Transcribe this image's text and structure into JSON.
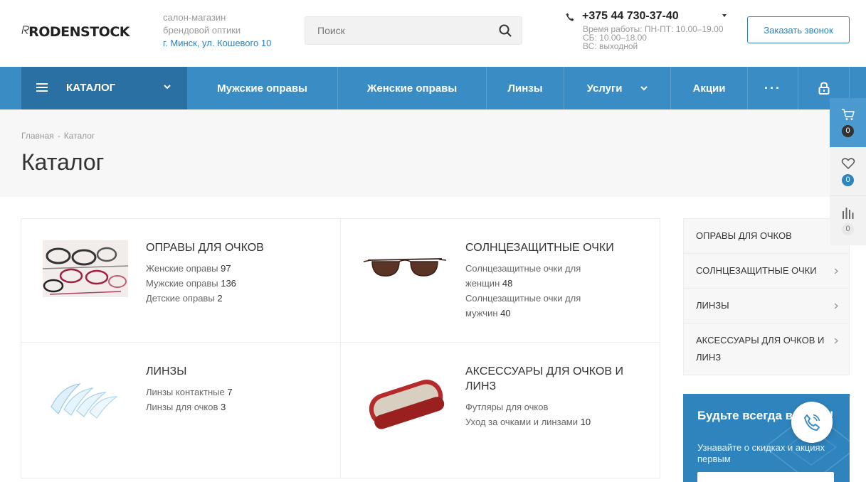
{
  "header": {
    "logo_text": "RODENSTOCK",
    "slogan_line1": "салон-магазин",
    "slogan_line2": "брендовой оптики",
    "address": "г. Минск, ул. Кошевого 10",
    "search_placeholder": "Поиск",
    "phone": "+375 44 730-37-40",
    "hours_line1": "Время работы: ПН-ПТ: 10.00–19.00",
    "hours_line2": "СБ: 10.00–18.00",
    "hours_line3": "ВС: выходной",
    "callback_label": "Заказать звонок"
  },
  "nav": {
    "catalog_label": "КАТАЛОГ",
    "items": [
      "Мужские оправы",
      "Женские оправы",
      "Линзы",
      "Услуги",
      "Акции",
      "···"
    ]
  },
  "breadcrumb": {
    "home": "Главная",
    "separator": "-",
    "current": "Каталог"
  },
  "page_title": "Каталог",
  "categories": [
    {
      "title": "ОПРАВЫ ДЛЯ ОЧКОВ",
      "links": [
        {
          "label": "Женские оправы",
          "count": "97"
        },
        {
          "label": "Мужские оправы",
          "count": "136"
        },
        {
          "label": "Детские оправы",
          "count": "2"
        }
      ]
    },
    {
      "title": "СОЛНЦЕЗАЩИТНЫЕ ОЧКИ",
      "links": [
        {
          "label": "Солнцезащитные очки для женщин",
          "count": "48"
        },
        {
          "label": "Солнцезащитные очки для мужчин",
          "count": "40"
        }
      ]
    },
    {
      "title": "ЛИНЗЫ",
      "links": [
        {
          "label": "Линзы контактные",
          "count": "7"
        },
        {
          "label": "Линзы для очков",
          "count": "3"
        }
      ]
    },
    {
      "title": "АКСЕССУАРЫ ДЛЯ ОЧКОВ И ЛИНЗ",
      "links": [
        {
          "label": "Футляры для очков",
          "count": ""
        },
        {
          "label": "Уход за очками и линзами",
          "count": "10"
        }
      ]
    }
  ],
  "sidebar": {
    "items": [
      "ОПРАВЫ ДЛЯ ОЧКОВ",
      "СОЛНЦЕЗАЩИТНЫЕ ОЧКИ",
      "ЛИНЗЫ",
      "АКСЕССУАРЫ ДЛЯ ОЧКОВ И ЛИНЗ"
    ]
  },
  "promo": {
    "title": "Будьте всегда в курсе!",
    "text": "Узнавайте о скидках и акциях первым"
  },
  "float_panel": {
    "cart_count": "0",
    "favorites_count": "0",
    "compare_count": "0"
  },
  "colors": {
    "accent": "#3a8dc4",
    "accent_dark": "#2a70a3",
    "link": "#2f7fb7"
  }
}
